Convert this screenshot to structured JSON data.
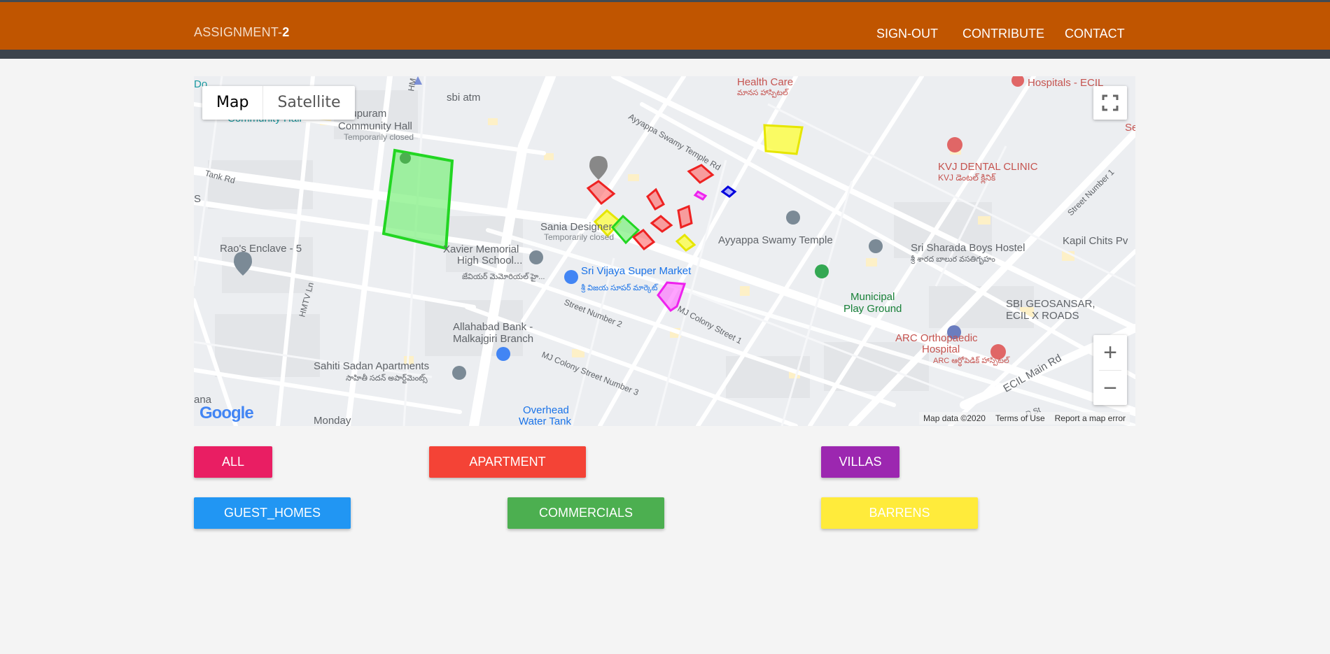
{
  "navbar": {
    "brand_prefix": "ASSIGNMENT-",
    "brand_suffix": "2",
    "links": [
      "SIGN-OUT",
      "CONTRIBUTE",
      "CONTACT"
    ]
  },
  "map": {
    "type_buttons": [
      "Map",
      "Satellite"
    ],
    "active_type": "Map",
    "zoom_in": "+",
    "zoom_out": "−",
    "footer": [
      "Map data ©2020",
      "Terms of Use",
      "Report a map error"
    ],
    "google": "Google",
    "labels": {
      "anupuram": "Anupuram",
      "community_hall": "Community Hall",
      "temp_closed_1": "Temporarily closed",
      "community_hall_partial": "Community Hall",
      "sbi_atm": "sbi atm",
      "health_care": "Health Care",
      "health_care_te": "మానస హాస్పిటల్",
      "hospitals_ecil": "Hospitals - ECIL",
      "kvj": "KVJ DENTAL CLINIC",
      "kvj_te": "KVJ డెంటల్ క్లినిక్",
      "ayyappa_rd": "Ayyappa Swamy Temple Rd",
      "ayyappa_temple": "Ayyappa Swamy Temple",
      "tank_rd": "Tank Rd",
      "raos": "Rao's Enclave - 5",
      "hmtv": "HMTV Ln",
      "hm": "HM",
      "sania": "Sania Designer",
      "temp_closed_2": "Temporarily closed",
      "xavier": "Xavier Memorial",
      "high_school": "High School...",
      "xavier_te": "జేవియర్ మెమోరియల్ హై...",
      "vijaya": "Sri Vijaya Super Market",
      "vijaya_te": "శ్రీ విజయ సూపర్ మార్కెట్",
      "sharada": "Sri Sharada Boys Hostel",
      "sharada_te": "శ్రీ శారద బాలుర వసతిగృహం",
      "kapil": "Kapil Chits Pv",
      "street_number_1": "Street Number 1",
      "municipal": "Municipal",
      "play_ground": "Play Ground",
      "mj_colony_1": "MJ Colony Street 1",
      "street_number_2": "Street Number 2",
      "mj_colony_3": "MJ Colony Street Number 3",
      "allahabad": "Allahabad Bank -",
      "malkajgiri": "Malkajgiri Branch",
      "sahiti": "Sahiti Sadan Apartments",
      "sahiti_te": "సాహితీ సదన్ అపార్ట్‌మెంట్స్",
      "overhead": "Overhead",
      "water_tank": "Water Tank",
      "monday": "Monday",
      "sbi_geo": "SBI GEOSANSAR,",
      "ecil_x": "ECIL X ROADS",
      "arc": "ARC Orthopaedic",
      "hospital": "Hospital",
      "arc_te": "ARC ఆర్థోపెడిక్ హాస్పిటల్",
      "ecil_main": "ECIL Main Rd",
      "d_st": "D St",
      "ana": "ana",
      "s_edge": "S",
      "doc_edge": "Do",
      "se_edge": "Se"
    }
  },
  "filters": {
    "all": "ALL",
    "apartment": "APARTMENT",
    "villas": "VILLAS",
    "guest_homes": "GUEST_HOMES",
    "commercials": "COMMERCIALS",
    "barrens": "BARRENS"
  },
  "colors": {
    "navbar": "#c05500",
    "all": "#e91e63",
    "apartment": "#f44336",
    "villas": "#9c27b0",
    "guest_homes": "#2196f3",
    "commercials": "#4caf50",
    "barrens": "#ffeb3b"
  }
}
